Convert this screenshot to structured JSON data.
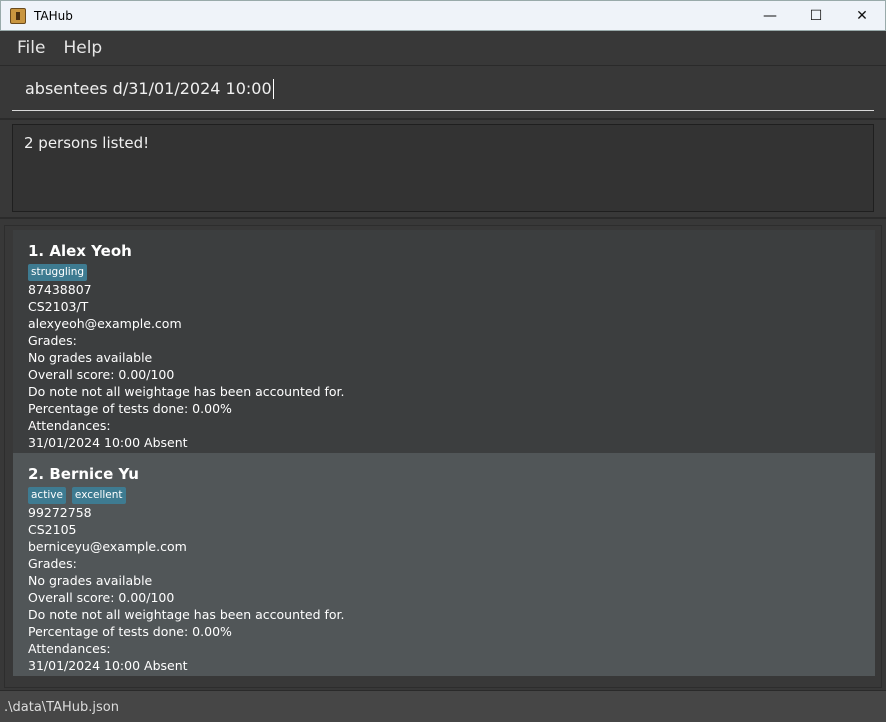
{
  "window": {
    "title": "TAHub",
    "minimize": "—",
    "maximize": "☐",
    "close": "✕"
  },
  "menu": [
    "File",
    "Help"
  ],
  "command": {
    "value": "absentees d/31/01/2024 10:00"
  },
  "result": "2 persons listed!",
  "persons": [
    {
      "name": "1. Alex Yeoh",
      "tags": [
        "struggling"
      ],
      "lines": [
        "87438807",
        "CS2103/T",
        "alexyeoh@example.com",
        "Grades:",
        "No grades available",
        "Overall score: 0.00/100",
        "Do note not all weightage has been accounted for.",
        "Percentage of tests done: 0.00%",
        "Attendances:",
        "31/01/2024 10:00 Absent"
      ]
    },
    {
      "name": "2. Bernice Yu",
      "tags": [
        "active",
        "excellent"
      ],
      "lines": [
        "99272758",
        "CS2105",
        "berniceyu@example.com",
        "Grades:",
        "No grades available",
        "Overall score: 0.00/100",
        "Do note not all weightage has been accounted for.",
        "Percentage of tests done: 0.00%",
        "Attendances:",
        "31/01/2024 10:00 Absent"
      ]
    }
  ],
  "status": ".\\data\\TAHub.json",
  "colors": {
    "tag": "#3e7b91",
    "selected_card": "#515658"
  }
}
